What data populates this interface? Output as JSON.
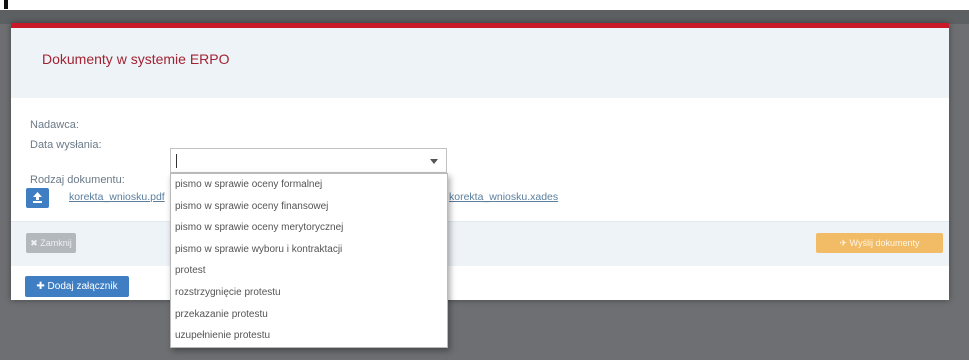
{
  "modal": {
    "title": "Dokumenty w systemie ERPO"
  },
  "form": {
    "sender_label": "Nadawca:",
    "sent_date_label": "Data wysłania:",
    "document_type_label": "Rodzaj dokumentu:",
    "document_type_value": ""
  },
  "attachments": {
    "left_link": "korekta_wniosku.pdf",
    "right_link": "korekta_wniosku.xades"
  },
  "footer": {
    "close_label": "✖ Zamknij",
    "send_label": "✈ Wyślij dokumenty",
    "add_attachment_label": "✚ Dodaj załącznik"
  },
  "dropdown": {
    "options": [
      "pismo w sprawie oceny formalnej",
      "pismo w sprawie oceny finansowej",
      "pismo w sprawie oceny merytorycznej",
      "pismo w sprawie wyboru i kontraktacji",
      "protest",
      "rozstrzygnięcie protestu",
      "przekazanie protestu",
      "uzupełnienie protestu"
    ]
  },
  "colors": {
    "accent_red": "#c9182a",
    "primary_blue": "#3f7ec2",
    "warning_orange": "#f2bb66",
    "header_bg": "#eef3f7"
  },
  "icons": {
    "upload": "upload-icon",
    "dropdown_arrow": "chevron-down-icon"
  }
}
